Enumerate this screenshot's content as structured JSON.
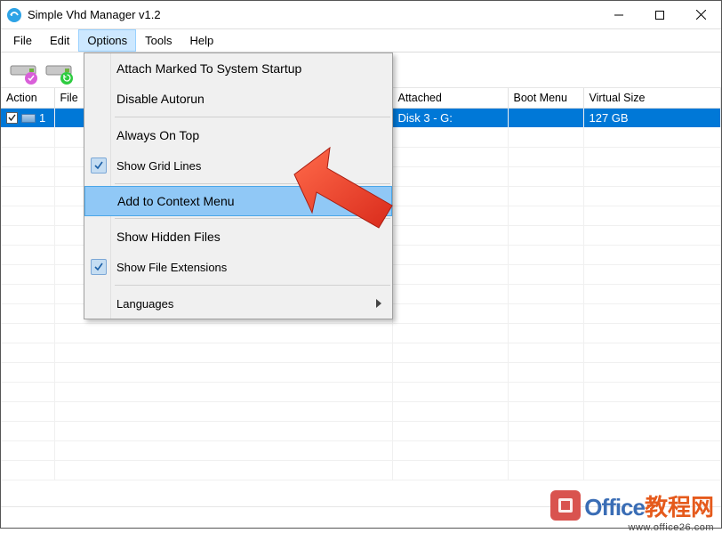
{
  "window": {
    "title": "Simple Vhd Manager v1.2"
  },
  "menu": {
    "file": "File",
    "edit": "Edit",
    "options": "Options",
    "tools": "Tools",
    "help": "Help"
  },
  "options_menu": {
    "attach_startup": "Attach Marked To System Startup",
    "disable_autorun": "Disable Autorun",
    "always_on_top": "Always On Top",
    "show_grid_lines": "Show Grid Lines",
    "add_context_menu": "Add to Context Menu",
    "show_hidden_files": "Show Hidden Files",
    "show_file_extensions": "Show File Extensions",
    "languages": "Languages"
  },
  "columns": {
    "action": "Action",
    "file": "File",
    "attached": "Attached",
    "boot_menu": "Boot Menu",
    "virtual_size": "Virtual Size"
  },
  "row": {
    "action": "1",
    "file": "",
    "attached": "Disk 3  -  G:",
    "boot_menu": "",
    "virtual_size": "127 GB"
  },
  "watermark": {
    "brand1": "Office",
    "brand2": "教程网",
    "url": "www.office26.com"
  }
}
